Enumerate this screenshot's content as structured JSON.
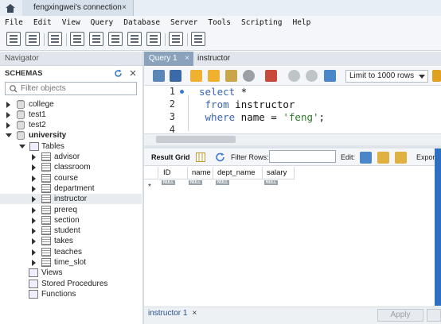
{
  "window": {
    "connection_tab": "fengxingwei's connection",
    "close_symbol": "×"
  },
  "menu": [
    "File",
    "Edit",
    "View",
    "Query",
    "Database",
    "Server",
    "Tools",
    "Scripting",
    "Help"
  ],
  "navigator": {
    "title": "Navigator",
    "schemas_label": "SCHEMAS",
    "filter_placeholder": "Filter objects",
    "schemas": [
      {
        "name": "college",
        "expanded": false
      },
      {
        "name": "test1",
        "expanded": false
      },
      {
        "name": "test2",
        "expanded": false
      },
      {
        "name": "university",
        "expanded": true
      }
    ],
    "tables_label": "Tables",
    "tables": [
      "advisor",
      "classroom",
      "course",
      "department",
      "instructor",
      "prereq",
      "section",
      "student",
      "takes",
      "teaches",
      "time_slot"
    ],
    "selected_table": "instructor",
    "views_label": "Views",
    "procedures_label": "Stored Procedures",
    "functions_label": "Functions"
  },
  "query_tabs": [
    {
      "label": "Query 1",
      "active": true
    },
    {
      "label": "instructor",
      "active": false
    }
  ],
  "query_toolbar": {
    "limit": "Limit to 1000 rows"
  },
  "editor": {
    "line_numbers": [
      "1",
      "2",
      "3",
      "4"
    ],
    "lines": [
      {
        "kw": "select",
        "rest": " *"
      },
      {
        "kw": " from",
        "rest": " instructor"
      },
      {
        "kw": " where",
        "rest": " name = ",
        "str": "'feng'",
        "end": ";"
      },
      {
        "kw": "",
        "rest": ""
      }
    ]
  },
  "result": {
    "result_grid_label": "Result Grid",
    "filter_rows_label": "Filter Rows:",
    "edit_label": "Edit:",
    "export_label": "Export/I",
    "columns": [
      "ID",
      "name",
      "dept_name",
      "salary"
    ],
    "null_label": "NULL",
    "new_row_marker": "*"
  },
  "bottom": {
    "tab_label": "instructor 1",
    "apply_label": "Apply"
  }
}
